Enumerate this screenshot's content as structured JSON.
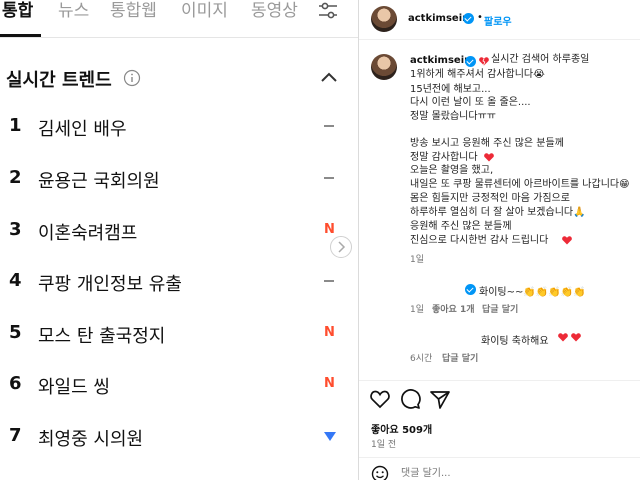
{
  "search_tabs": [
    "통합",
    "뉴스",
    "통합웹",
    "이미지",
    "동영상"
  ],
  "trend_section": {
    "title": "실시간 트렌드",
    "items": [
      {
        "rank": "1",
        "term": "김세인 배우",
        "status": "same"
      },
      {
        "rank": "2",
        "term": "윤용근 국회의원",
        "status": "same"
      },
      {
        "rank": "3",
        "term": "이혼숙려캠프",
        "status": "new",
        "badge": "N"
      },
      {
        "rank": "4",
        "term": "쿠팡 개인정보 유출",
        "status": "same"
      },
      {
        "rank": "5",
        "term": "모스 탄 출국정지",
        "status": "new",
        "badge": "N"
      },
      {
        "rank": "6",
        "term": "와일드 씽",
        "status": "new",
        "badge": "N"
      },
      {
        "rank": "7",
        "term": "최영중 시의원",
        "status": "down"
      }
    ]
  },
  "post": {
    "username": "actkimsein",
    "follow_label": "팔로우",
    "caption_lines": [
      "actkimsein",
      "실시간 검색어 하루종일",
      "1위하게 해주셔서 감사합니다😭",
      "15년전에 해보고...",
      "다시 이런 날이 또 올 줄은....",
      "정말 몰랐습니다ㅠㅠ",
      "방송 보시고 응원해 주신 많은 분들께",
      "정말 감사합니다",
      "오늘은 촬영을 했고,",
      "내일은 또 쿠팡 물류센터에 아르바이트를 나갑니다😁",
      "몸은 힘들지만 긍정적인 마음 가짐으로",
      "하루하루 열심히 더 잘 살아 보겠습니다🙏",
      "응원해 주신 많은 분들께",
      "진심으로 다시한번 감사 드립니다"
    ],
    "caption_age": "1일",
    "comments": [
      {
        "text": "화이팅~~👏👏👏👏👏",
        "age": "1일",
        "likes": "좋아요 1개",
        "reply": "답글 달기"
      },
      {
        "text": "화이팅 축하해요",
        "age": "6시간",
        "reply": "답글 달기"
      }
    ],
    "likes": "좋아요 509개",
    "time_ago": "1일 전",
    "comment_placeholder": "댓글 달기..."
  },
  "colors": {
    "new_badge": "#ff4d2e",
    "down_arrow": "#3478f6",
    "verified": "#0095f6",
    "heart": "#ed2a37"
  }
}
